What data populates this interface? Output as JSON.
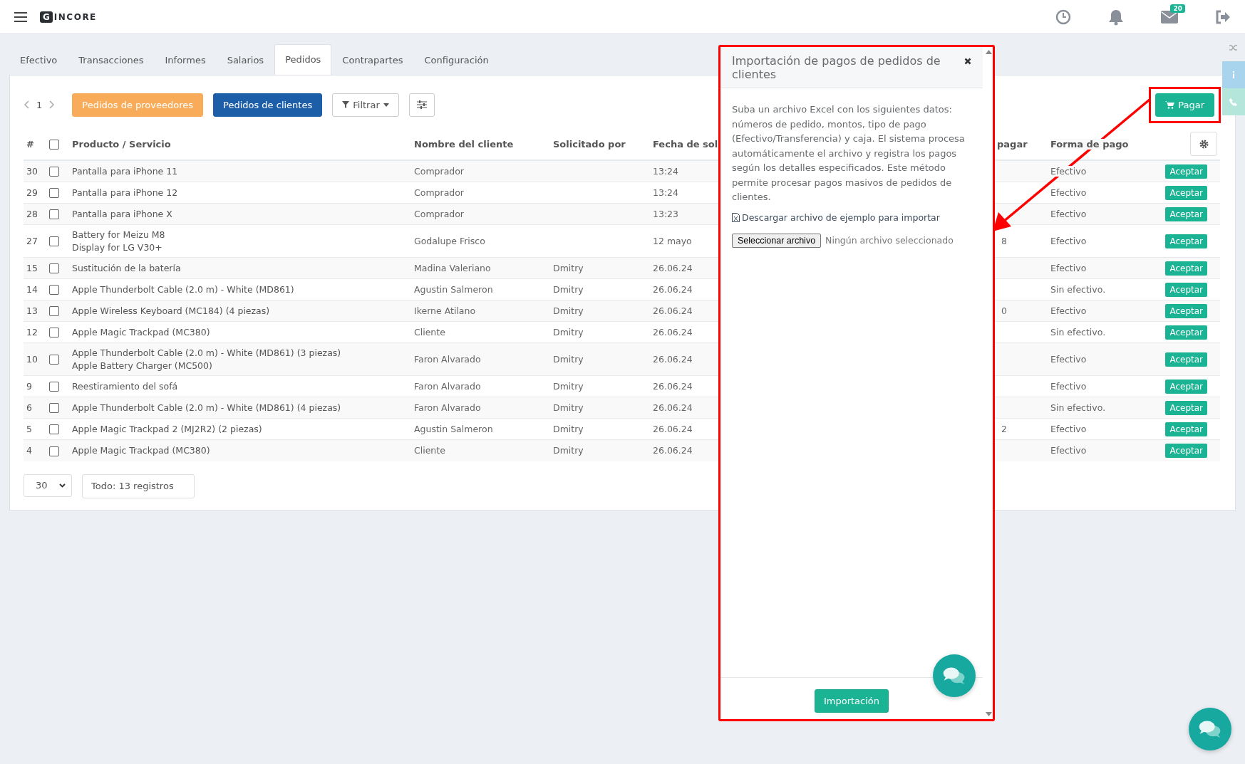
{
  "topbar": {
    "logo_mark": "G",
    "logo_text": "INCORE",
    "mail_badge": "20"
  },
  "tabs": [
    {
      "label": "Efectivo",
      "selected": false
    },
    {
      "label": "Transacciones",
      "selected": false
    },
    {
      "label": "Informes",
      "selected": false
    },
    {
      "label": "Salarios",
      "selected": false
    },
    {
      "label": "Pedidos",
      "selected": true
    },
    {
      "label": "Contrapartes",
      "selected": false
    },
    {
      "label": "Configuración",
      "selected": false
    }
  ],
  "toolbar": {
    "page": "1",
    "buttons": [
      {
        "label": "Pedidos de proveedores",
        "kind": "orange"
      },
      {
        "label": "Pedidos de clientes",
        "kind": "blue"
      }
    ],
    "filter": "Filtrar",
    "pay_button": "Pagar"
  },
  "table": {
    "header_checked": false,
    "columns": [
      "#",
      "Producto / Servicio",
      "Nombre del cliente",
      "Solicitado por",
      "Fecha de sol",
      "pagar",
      "Forma de pago"
    ],
    "rows": [
      {
        "id": "30",
        "checked": false,
        "products": [
          "Pantalla para iPhone 11"
        ],
        "client": "Comprador",
        "date": "13:24",
        "payment": "Efectivo",
        "action": "Aceptar"
      },
      {
        "id": "29",
        "checked": false,
        "products": [
          "Pantalla para iPhone 12"
        ],
        "client": "Comprador",
        "date": "13:24",
        "payment": "Efectivo",
        "action": "Aceptar"
      },
      {
        "id": "28",
        "checked": false,
        "products": [
          "Pantalla para iPhone X"
        ],
        "client": "Comprador",
        "date": "13:23",
        "payment": "Efectivo",
        "action": "Aceptar"
      },
      {
        "id": "27",
        "checked": false,
        "products": [
          "Battery for Meizu M8",
          "Display for LG V30+"
        ],
        "client": "Godalupe Frisco",
        "date": "12 mayo",
        "column_7": "8",
        "payment": "Efectivo",
        "action": "Aceptar"
      },
      {
        "id": "15",
        "checked": false,
        "products": [
          "Sustitución de la batería"
        ],
        "client": "Madina Valeriano",
        "requested_by": "Dmitry",
        "date": "26.06.24",
        "payment": "Efectivo",
        "action": "Aceptar"
      },
      {
        "id": "14",
        "checked": false,
        "products": [
          "Apple Thunderbolt Cable (2.0 m) - White (MD861)"
        ],
        "client": "Agustin Salmeron",
        "requested_by": "Dmitry",
        "date": "26.06.24",
        "payment": "Sin efectivo.",
        "action": "Aceptar"
      },
      {
        "id": "13",
        "checked": false,
        "products": [
          "Apple Wireless Keyboard (MC184) (4 piezas)"
        ],
        "client": "Ikerne Atilano",
        "requested_by": "Dmitry",
        "date": "26.06.24",
        "column_7": "0",
        "payment": "Efectivo",
        "action": "Aceptar"
      },
      {
        "id": "12",
        "checked": false,
        "products": [
          "Apple Magic Trackpad (MC380)"
        ],
        "client": "Cliente",
        "requested_by": "Dmitry",
        "date": "26.06.24",
        "payment": "Sin efectivo.",
        "action": "Aceptar"
      },
      {
        "id": "10",
        "checked": false,
        "products": [
          "Apple Thunderbolt Cable (2.0 m) - White (MD861) (3 piezas)",
          "Apple Battery Charger (MC500)"
        ],
        "client": "Faron Alvarado",
        "requested_by": "Dmitry",
        "date": "26.06.24",
        "payment": "Efectivo",
        "action": "Aceptar"
      },
      {
        "id": "9",
        "checked": false,
        "products": [
          "Reestiramiento del sofá"
        ],
        "client": "Faron Alvarado",
        "requested_by": "Dmitry",
        "date": "26.06.24",
        "payment": "Efectivo",
        "action": "Aceptar"
      },
      {
        "id": "6",
        "checked": false,
        "products": [
          "Apple Thunderbolt Cable (2.0 m) - White (MD861) (4 piezas)"
        ],
        "client": "Faron Alvarado",
        "requested_by": "Dmitry",
        "date": "26.06.24",
        "payment": "Sin efectivo.",
        "action": "Aceptar"
      },
      {
        "id": "5",
        "checked": false,
        "products": [
          "Apple Magic Trackpad 2 (MJ2R2) (2 piezas)"
        ],
        "client": "Agustin Salmeron",
        "requested_by": "Dmitry",
        "date": "26.06.24",
        "column_7": "2",
        "payment": "Efectivo",
        "action": "Aceptar"
      },
      {
        "id": "4",
        "checked": false,
        "products": [
          "Apple Magic Trackpad (MC380)"
        ],
        "client": "Cliente",
        "requested_by": "Dmitry",
        "date": "26.06.24",
        "payment": "Efectivo",
        "action": "Aceptar"
      }
    ]
  },
  "footer": {
    "page_size": "30",
    "total": "Todo: 13 registros"
  },
  "modal": {
    "title": "Importación de pagos de pedidos de clientes",
    "description": "Suba un archivo Excel con los siguientes datos: números de pedido, montos, tipo de pago (Efectivo/Transferencia) y caja. El sistema procesa automáticamente el archivo y registra los pagos según los detalles especificados. Este método permite procesar pagos masivos de pedidos de clientes.",
    "download_link": "Descargar archivo de ejemplo para importar",
    "file_button": "Seleccionar archivo",
    "file_status": "Ningún archivo seleccionado",
    "submit": "Importación"
  }
}
